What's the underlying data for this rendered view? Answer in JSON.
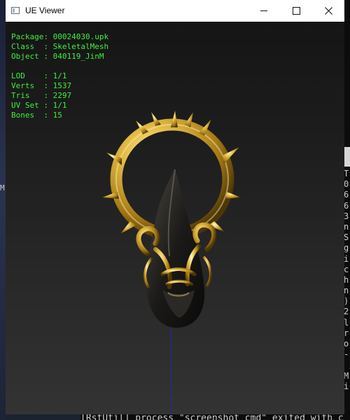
{
  "window": {
    "title": "UE Viewer",
    "controls": {
      "minimize": "minimize",
      "maximize": "maximize",
      "close": "close"
    }
  },
  "info": {
    "package_label": "Package:",
    "package_value": "00024030.upk",
    "class_label": "Class  :",
    "class_value": "SkeletalMesh",
    "object_label": "Object :",
    "object_value": "040119_JinM",
    "lod_label": "LOD    :",
    "lod_value": "1/1",
    "verts_label": "Verts  :",
    "verts_value": "1537",
    "tris_label": "Tris   :",
    "tris_value": "2297",
    "uvset_label": "UV Set :",
    "uvset_value": "1/1",
    "bones_label": "Bones  :",
    "bones_value": "15"
  },
  "background": {
    "left_char": "M",
    "right_column": [
      "T",
      "0",
      "6",
      "6",
      "3",
      "n",
      "S",
      "g",
      "i",
      "c",
      "h",
      "n",
      ")",
      "2",
      "l",
      "r",
      "o",
      "-",
      "",
      "M",
      "i"
    ],
    "bottom_terminal": "[RstUtil] process \"screenshot_cmd\" exited with c"
  },
  "colors": {
    "info_text": "#3cf03c",
    "titlebar": "#ffffff",
    "viewport_top": "#151515",
    "viewport_bottom": "#333333",
    "axis": "#1d2aa8",
    "gold": "#d9a92a"
  },
  "icons": {
    "app": "window-app-icon",
    "minimize": "minimize-icon",
    "maximize": "maximize-icon",
    "close": "close-icon"
  }
}
